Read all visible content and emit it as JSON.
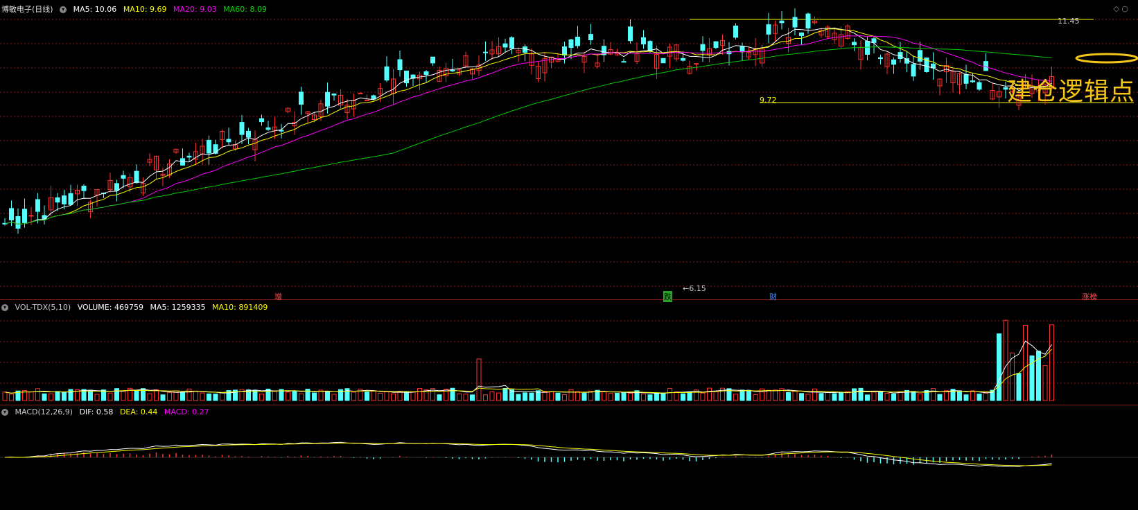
{
  "main": {
    "title": "博敏电子(日线)",
    "ma5": "MA5: 10.06",
    "ma10": "MA10: 9.69",
    "ma20": "MA20: 9.03",
    "ma60": "MA60: 8.09",
    "high_label": "11.45",
    "level_label": "9.72",
    "low_label": "6.15",
    "annotation": "建仓逻辑点",
    "markers": [
      "增",
      "跌",
      "财",
      "涨榜"
    ]
  },
  "volume": {
    "title": "VOL-TDX(5,10)",
    "volume": "VOLUME: 469759",
    "ma5": "MA5: 1259335",
    "ma10": "MA10: 891409"
  },
  "macd": {
    "title": "MACD(12,26,9)",
    "dif": "DIF: 0.58",
    "dea": "DEA: 0.44",
    "macd": "MACD: 0.27"
  },
  "colors": {
    "up": "#ff3030",
    "down": "#54ffff",
    "ma5": "#ffffff",
    "ma10": "#ffff00",
    "ma20": "#ff00ff",
    "ma60": "#00cc00",
    "grid": "#8a1c1c",
    "annotation": "#f5c518"
  },
  "chart_data": {
    "type": "candlestick",
    "price_range": [
      6.15,
      11.45
    ],
    "key_levels": [
      11.45,
      9.72,
      6.15
    ],
    "trend_points": [
      7.2,
      8.1,
      9.0,
      9.9,
      10.6,
      10.8,
      10.7,
      11.45,
      10.3,
      10.06
    ]
  }
}
